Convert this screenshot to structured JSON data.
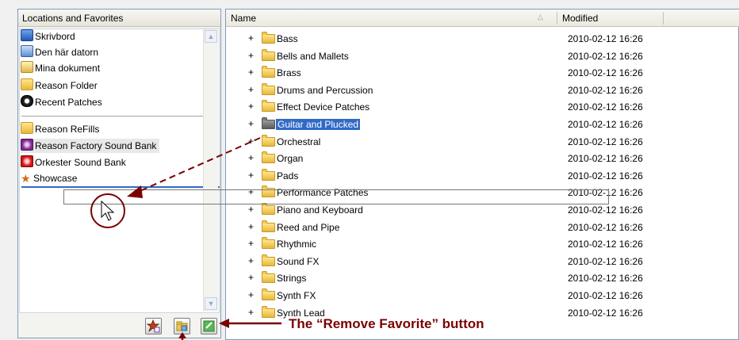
{
  "left_panel": {
    "header": "Locations and Favorites",
    "items": [
      {
        "label": "Skrivbord",
        "icon": "desktop-icon"
      },
      {
        "label": "Den här datorn",
        "icon": "computer-icon"
      },
      {
        "label": "Mina dokument",
        "icon": "documents-folder-icon"
      },
      {
        "label": "Reason Folder",
        "icon": "folder-icon"
      },
      {
        "label": "Recent Patches",
        "icon": "recent-patches-icon"
      }
    ],
    "favorites": [
      {
        "label": "Reason ReFills",
        "icon": "folder-icon"
      },
      {
        "label": "Reason Factory Sound Bank",
        "icon": "refill-purple-icon",
        "selected": true
      },
      {
        "label": "Orkester Sound Bank",
        "icon": "refill-red-icon"
      },
      {
        "label": "Showcase",
        "icon": "star-icon"
      }
    ]
  },
  "right_panel": {
    "columns": {
      "name": "Name",
      "modified": "Modified"
    },
    "rows": [
      {
        "name": "Bass",
        "modified": "2010-02-12 16:26"
      },
      {
        "name": "Bells and Mallets",
        "modified": "2010-02-12 16:26"
      },
      {
        "name": "Brass",
        "modified": "2010-02-12 16:26"
      },
      {
        "name": "Drums and Percussion",
        "modified": "2010-02-12 16:26"
      },
      {
        "name": "Effect Device Patches",
        "modified": "2010-02-12 16:26"
      },
      {
        "name": "Guitar and Plucked",
        "modified": "2010-02-12 16:26",
        "selected": true
      },
      {
        "name": "Orchestral",
        "modified": "2010-02-12 16:26"
      },
      {
        "name": "Organ",
        "modified": "2010-02-12 16:26"
      },
      {
        "name": "Pads",
        "modified": "2010-02-12 16:26"
      },
      {
        "name": "Performance Patches",
        "modified": "2010-02-12 16:26"
      },
      {
        "name": "Piano and Keyboard",
        "modified": "2010-02-12 16:26"
      },
      {
        "name": "Reed and Pipe",
        "modified": "2010-02-12 16:26"
      },
      {
        "name": "Rhythmic",
        "modified": "2010-02-12 16:26"
      },
      {
        "name": "Sound FX",
        "modified": "2010-02-12 16:26"
      },
      {
        "name": "Strings",
        "modified": "2010-02-12 16:26"
      },
      {
        "name": "Synth FX",
        "modified": "2010-02-12 16:26"
      },
      {
        "name": "Synth Lead",
        "modified": "2010-02-12 16:26"
      }
    ],
    "expander_symbol": "+"
  },
  "toolbar": {
    "add_favorite_icon": "star-add-icon",
    "add_folder_icon": "folder-add-icon",
    "remove_favorite_icon": "remove-favorite-icon"
  },
  "annotation": {
    "callout": "The “Remove Favorite” button"
  },
  "colors": {
    "selection": "#316ac5",
    "callout": "#7a0000",
    "border": "#7f9db9"
  }
}
